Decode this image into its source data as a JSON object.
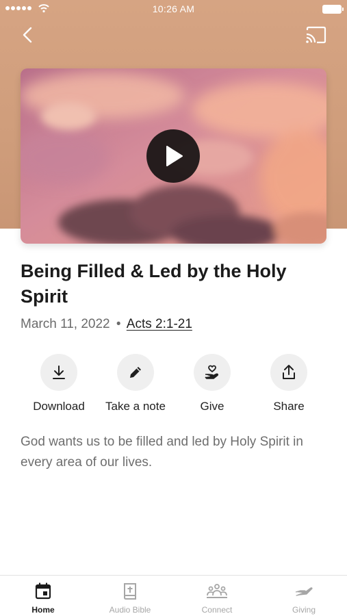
{
  "status_bar": {
    "time": "10:26 AM"
  },
  "sermon": {
    "title": "Being Filled & Led by the Holy Spirit",
    "date": "March 11, 2022",
    "separator": "•",
    "scripture": "Acts 2:1-21",
    "description": "God wants us to be filled and led by Holy Spirit in every area of our lives."
  },
  "actions": [
    {
      "label": "Download",
      "icon": "download-icon"
    },
    {
      "label": "Take a note",
      "icon": "pencil-icon"
    },
    {
      "label": "Give",
      "icon": "hand-heart-icon"
    },
    {
      "label": "Share",
      "icon": "share-icon"
    }
  ],
  "tabs": [
    {
      "label": "Home",
      "icon": "calendar-icon",
      "active": true
    },
    {
      "label": "Audio Bible",
      "icon": "bible-icon",
      "active": false
    },
    {
      "label": "Connect",
      "icon": "people-icon",
      "active": false
    },
    {
      "label": "Giving",
      "icon": "giving-hand-icon",
      "active": false
    }
  ],
  "colors": {
    "header_bg": "#d6a483",
    "accent": "#1b1b1b",
    "muted": "#6e6e6e"
  }
}
